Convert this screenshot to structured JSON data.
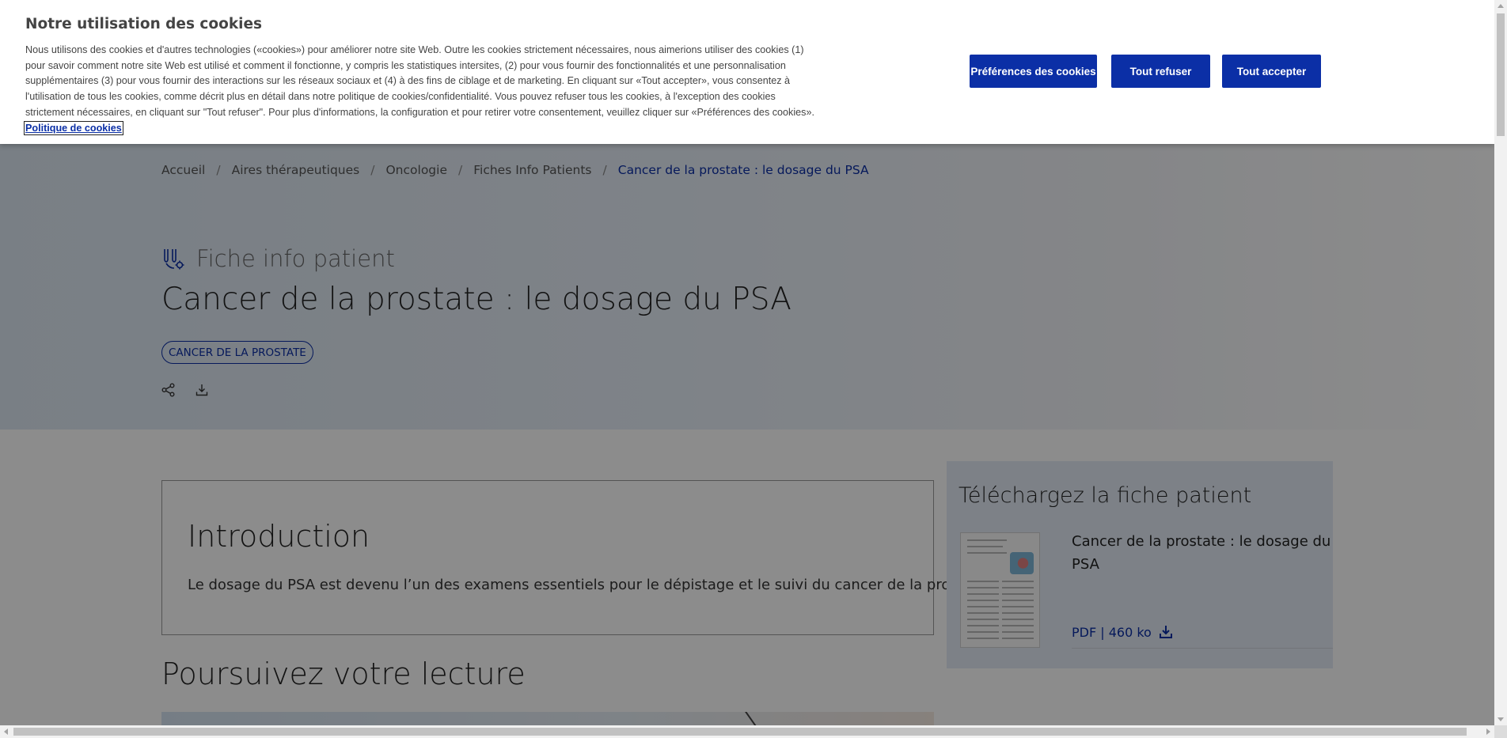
{
  "cookie_banner": {
    "title": "Notre utilisation des cookies",
    "text": "Nous utilisons des cookies et d'autres technologies («cookies») pour améliorer notre site Web. Outre les cookies strictement nécessaires, nous aimerions utiliser des cookies (1) pour savoir comment notre site Web est utilisé et comment il fonctionne, y compris les statistiques intersites, (2) pour vous fournir des fonctionnalités et une personnalisation supplémentaires (3) pour vous fournir des interactions sur les réseaux sociaux et (4) à des fins de ciblage et de marketing. En cliquant sur «Tout accepter», vous consentez à l'utilisation de tous les cookies, comme décrit plus en détail dans notre politique de cookies/confidentialité. Vous pouvez refuser tous les cookies, à l'exception des cookies strictement nécessaires, en cliquant sur \"Tout refuser\". Pour plus d'informations, la configuration et pour retirer votre consentement, veuillez cliquer sur «Préférences des cookies».",
    "policy_link": "Politique de cookies",
    "buttons": {
      "preferences": "Préférences des cookies",
      "refuse": "Tout refuser",
      "accept": "Tout accepter"
    },
    "button_color": "#0b2fa6"
  },
  "breadcrumb": {
    "items": [
      "Accueil",
      "Aires thérapeutiques",
      "Oncologie",
      "Fiches Info Patients"
    ],
    "current": "Cancer de la prostate : le dosage du PSA",
    "separator": "/"
  },
  "hero": {
    "kicker": "Fiche info patient",
    "kicker_icon": "patient-info-icon",
    "title": "Cancer de la prostate : le dosage du PSA",
    "tag": "CANCER DE LA PROSTATE",
    "actions": [
      "share-icon",
      "download-icon"
    ]
  },
  "intro": {
    "title": "Introduction",
    "text": "Le dosage du PSA est devenu l’un des examens essentiels pour le dépistage et le suivi du cancer de la prostate."
  },
  "continue_reading": {
    "title": "Poursuivez votre lecture"
  },
  "download": {
    "title": "Téléchargez la fiche patient",
    "document_title": "Cancer de la prostate : le dosage du PSA",
    "meta": "PDF | 460 ko",
    "icon": "download-icon"
  },
  "colors": {
    "accent": "#0b2fa6",
    "hero_bg": "#dde8f3",
    "sidebar_bg": "#e3ecf6"
  }
}
